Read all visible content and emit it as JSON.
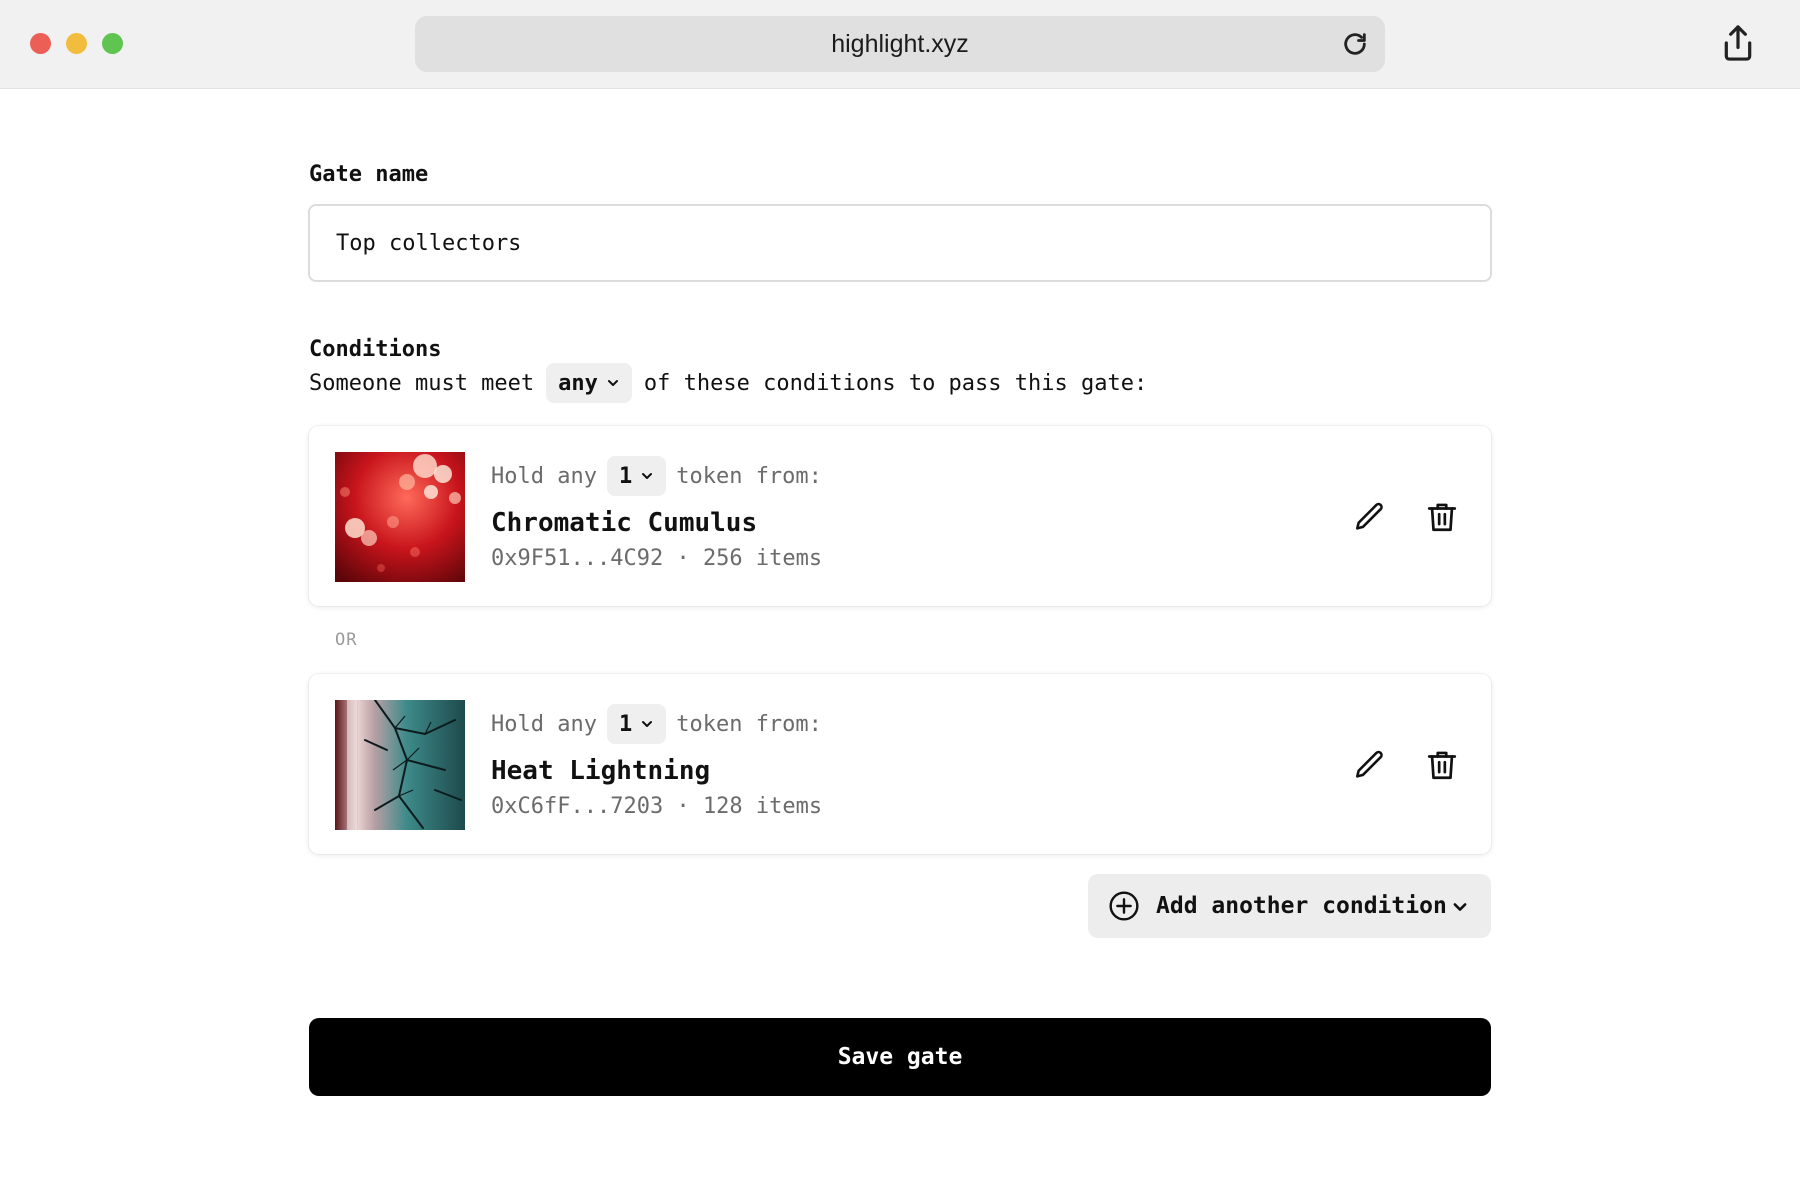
{
  "browser": {
    "url": "highlight.xyz",
    "icons": {
      "reload": "reload-icon",
      "share": "share-icon"
    }
  },
  "form": {
    "gate_name_label": "Gate name",
    "gate_name_value": "Top collectors",
    "conditions_label": "Conditions",
    "sentence_prefix": "Someone must meet",
    "match_mode": "any",
    "sentence_suffix": "of these conditions to pass this gate:",
    "or_separator": "OR"
  },
  "conditions": [
    {
      "hold_prefix": "Hold any",
      "quantity": "1",
      "hold_suffix": "token from:",
      "collection_name": "Chromatic Cumulus",
      "contract": "0x9F51...4C92",
      "separator": "·",
      "item_count": "256 items"
    },
    {
      "hold_prefix": "Hold any",
      "quantity": "1",
      "hold_suffix": "token from:",
      "collection_name": "Heat Lightning",
      "contract": "0xC6fF...7203",
      "separator": "·",
      "item_count": "128 items"
    }
  ],
  "actions": {
    "add_condition_label": "Add another condition",
    "save_label": "Save gate"
  },
  "colors": {
    "primary_button": "#000000",
    "traffic_red": "#ec5f56",
    "traffic_yellow": "#f2bc3c",
    "traffic_green": "#5fc450"
  }
}
